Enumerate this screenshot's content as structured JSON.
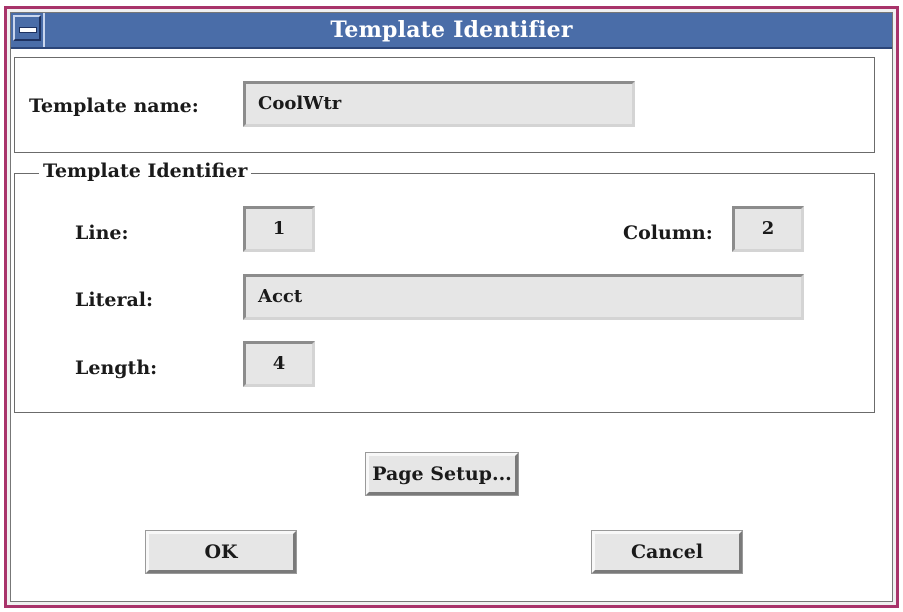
{
  "window": {
    "title": "Template Identifier"
  },
  "name_section": {
    "label": "Template name:",
    "value": "CoolWtr"
  },
  "identifier_group": {
    "title": "Template Identifier",
    "line_label": "Line:",
    "line_value": "1",
    "column_label": "Column:",
    "column_value": "2",
    "literal_label": "Literal:",
    "literal_value": "Acct",
    "length_label": "Length:",
    "length_value": "4"
  },
  "buttons": {
    "page_setup": "Page Setup...",
    "ok": "OK",
    "cancel": "Cancel"
  },
  "colors": {
    "titlebar": "#4a6da8",
    "window_border": "#a8336a",
    "field_bg": "#e6e6e6"
  }
}
